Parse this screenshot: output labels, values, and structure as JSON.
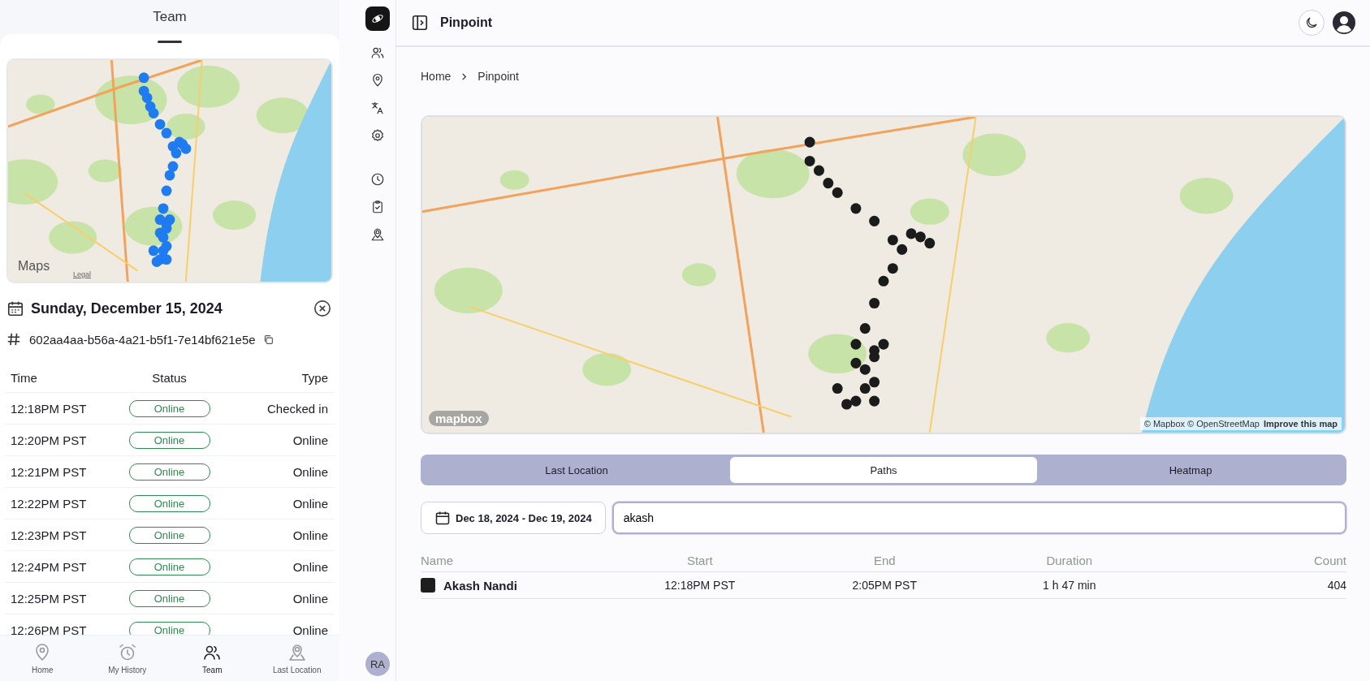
{
  "left_panel": {
    "title": "Team",
    "map": {
      "logo": "Maps",
      "legal": "Legal"
    },
    "date": "Sunday, December 15, 2024",
    "id": "602aa4aa-b56a-4a21-b5f1-7e14bf621e5e",
    "table": {
      "columns": [
        "Time",
        "Status",
        "Type"
      ],
      "rows": [
        {
          "time": "12:18PM PST",
          "status": "Online",
          "type": "Checked in"
        },
        {
          "time": "12:20PM PST",
          "status": "Online",
          "type": "Online"
        },
        {
          "time": "12:21PM PST",
          "status": "Online",
          "type": "Online"
        },
        {
          "time": "12:22PM PST",
          "status": "Online",
          "type": "Online"
        },
        {
          "time": "12:23PM PST",
          "status": "Online",
          "type": "Online"
        },
        {
          "time": "12:24PM PST",
          "status": "Online",
          "type": "Online"
        },
        {
          "time": "12:25PM PST",
          "status": "Online",
          "type": "Online"
        },
        {
          "time": "12:26PM PST",
          "status": "Online",
          "type": "Online"
        }
      ]
    },
    "bottom_nav": [
      {
        "kind": "pin",
        "label": "Home",
        "selected": false
      },
      {
        "kind": "alarm",
        "label": "My History",
        "selected": false
      },
      {
        "kind": "team",
        "label": "Team",
        "selected": true
      },
      {
        "kind": "location",
        "label": "Last Location",
        "selected": false
      }
    ]
  },
  "sidebar": {
    "items": [
      {
        "kind": "team"
      },
      {
        "kind": "pin"
      },
      {
        "kind": "translate"
      },
      {
        "kind": "gear"
      },
      {
        "kind": "gap"
      },
      {
        "kind": "clock"
      },
      {
        "kind": "clipboard"
      },
      {
        "kind": "location"
      }
    ],
    "avatar": "RA"
  },
  "topbar": {
    "title": "Pinpoint"
  },
  "breadcrumb": [
    "Home",
    "Pinpoint"
  ],
  "map": {
    "logo": "mapbox",
    "attribution": "© Mapbox © OpenStreetMap",
    "improve_link": "Improve this map"
  },
  "tabs": [
    {
      "label": "Last Location",
      "selected": false
    },
    {
      "label": "Paths",
      "selected": true
    },
    {
      "label": "Heatmap",
      "selected": false
    }
  ],
  "date_range": "Dec 18, 2024 - Dec 19, 2024",
  "search": {
    "value": "akash"
  },
  "paths_table": {
    "columns": [
      "Name",
      "Start",
      "End",
      "Duration",
      "Count"
    ],
    "rows": [
      {
        "color": "#1e1e1e",
        "name": "Akash Nandi",
        "start": "12:18PM PST",
        "end": "2:05PM PST",
        "duration": "1 h 47 min",
        "count": "404"
      }
    ]
  }
}
